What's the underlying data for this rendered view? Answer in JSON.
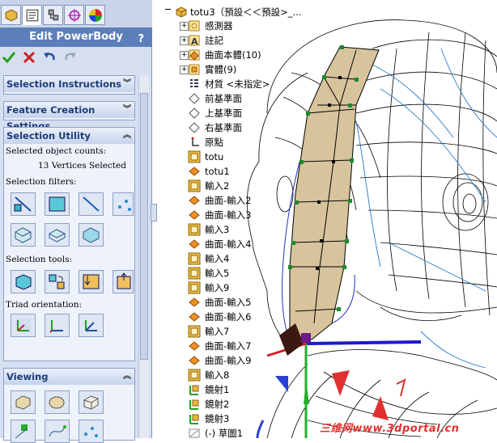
{
  "propertymanager": {
    "title": "Edit PowerBody",
    "help_label": "?",
    "tabs": [
      "featuremanager-tab",
      "propertymanager-tab",
      "configurationmanager-tab",
      "dimxpert-tab",
      "display-tab"
    ],
    "actions": [
      "ok-check-icon",
      "cancel-x-icon",
      "undo-icon",
      "redo-icon"
    ]
  },
  "sections": {
    "selection_instructions": "Selection Instructions",
    "feature_creation_settings": "Feature Creation Settings",
    "selection_utility": "Selection Utility",
    "viewing": "Viewing"
  },
  "selection_utility": {
    "counts_label": "Selected object counts:",
    "counts_value": "13 Vertices Selected",
    "filters_label": "Selection filters:",
    "tools_label": "Selection tools:",
    "triad_label": "Triad orientation:"
  },
  "tree": {
    "root": "totu3（預設＜＜預設>_...",
    "items": [
      {
        "label": "感測器",
        "icon": "sensor-icon"
      },
      {
        "label": "註記",
        "icon": "annotation-icon"
      },
      {
        "label": "曲面本體(10)",
        "icon": "surface-bodies-icon"
      },
      {
        "label": "實體(9)",
        "icon": "solid-bodies-icon"
      },
      {
        "label": "材質 <未指定>",
        "icon": "material-icon"
      },
      {
        "label": "前基準面",
        "icon": "plane-icon"
      },
      {
        "label": "上基準面",
        "icon": "plane-icon"
      },
      {
        "label": "右基準面",
        "icon": "plane-icon"
      },
      {
        "label": "原點",
        "icon": "origin-icon"
      },
      {
        "label": "totu",
        "icon": "import-icon"
      },
      {
        "label": "totu1",
        "icon": "surface-icon"
      },
      {
        "label": "輸入2",
        "icon": "import-icon"
      },
      {
        "label": "曲面-輸入2",
        "icon": "surface-icon"
      },
      {
        "label": "曲面-輸入3",
        "icon": "surface-icon"
      },
      {
        "label": "輸入3",
        "icon": "import-icon"
      },
      {
        "label": "曲面-輸入4",
        "icon": "surface-icon"
      },
      {
        "label": "輸入4",
        "icon": "import-icon"
      },
      {
        "label": "輸入5",
        "icon": "import-icon"
      },
      {
        "label": "輸入9",
        "icon": "import-icon"
      },
      {
        "label": "曲面-輸入5",
        "icon": "surface-icon"
      },
      {
        "label": "曲面-輸入6",
        "icon": "surface-icon"
      },
      {
        "label": "輸入7",
        "icon": "import-icon"
      },
      {
        "label": "曲面-輸入7",
        "icon": "surface-icon"
      },
      {
        "label": "曲面-輸入9",
        "icon": "surface-icon"
      },
      {
        "label": "輸入8",
        "icon": "import-icon"
      },
      {
        "label": "鏡射1",
        "icon": "mirror-icon"
      },
      {
        "label": "鏡射2",
        "icon": "mirror-icon"
      },
      {
        "label": "鏡射3",
        "icon": "mirror-icon"
      },
      {
        "label": "(-) 草圖1",
        "icon": "sketch-icon"
      }
    ]
  },
  "watermark": "三维网www.3dportal.cn"
}
